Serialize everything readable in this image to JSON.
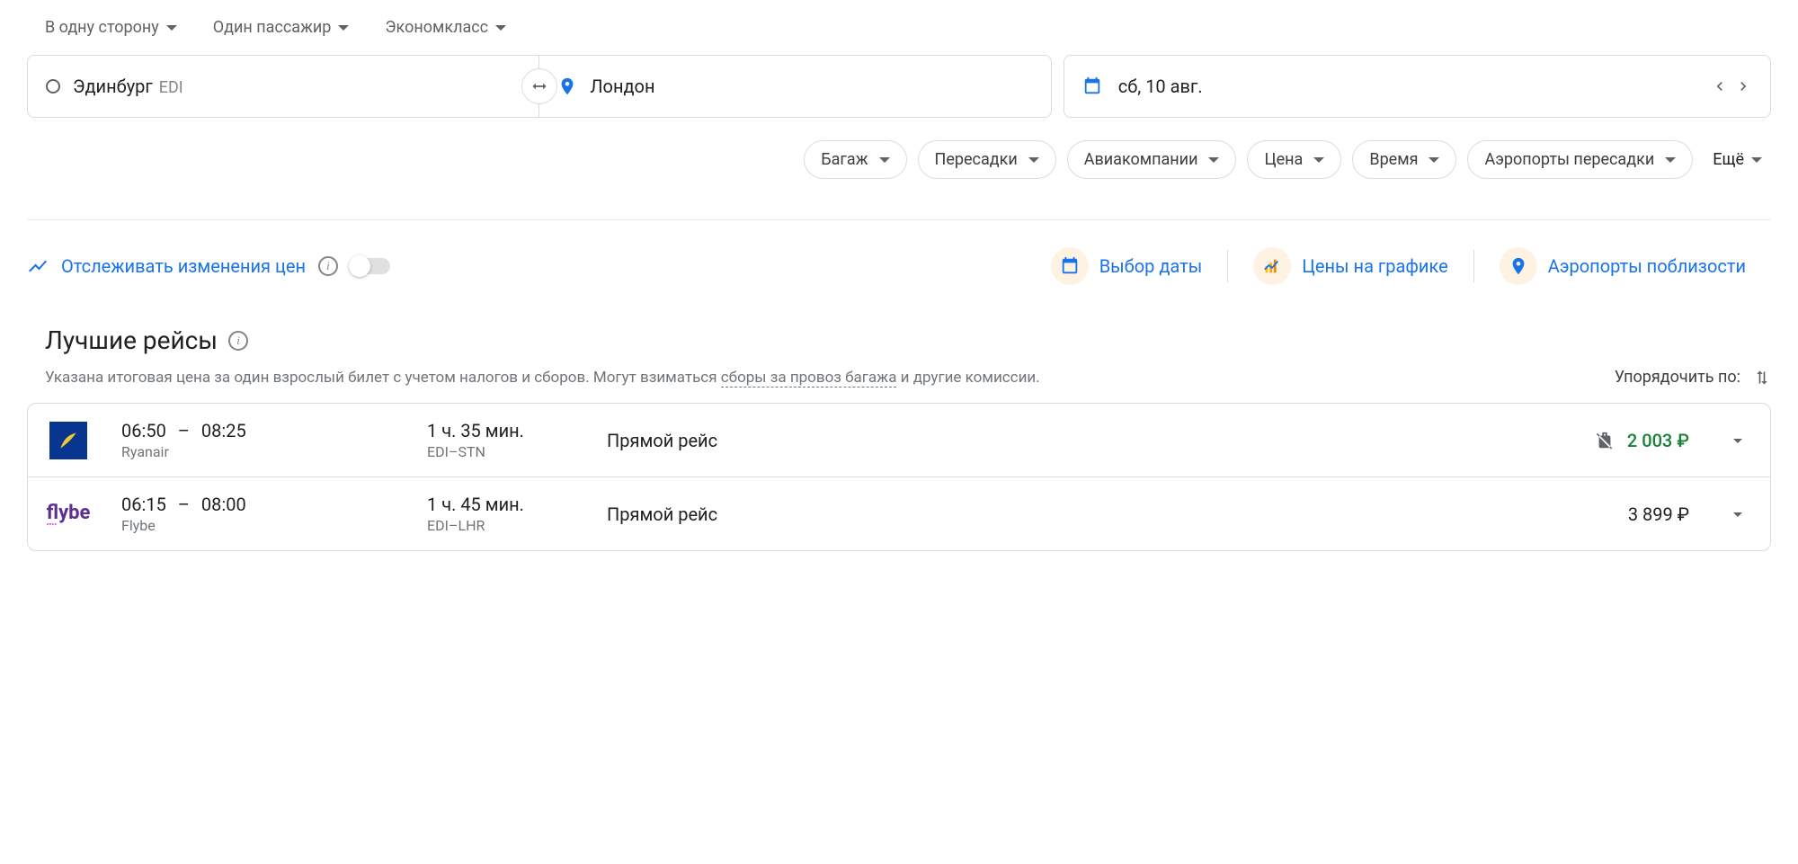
{
  "topFilters": {
    "tripType": "В одну сторону",
    "passengers": "Один пассажир",
    "cabin": "Экономкласс"
  },
  "search": {
    "origin": "Эдинбург",
    "originCode": "EDI",
    "destination": "Лондон",
    "date": "сб, 10 авг."
  },
  "chips": {
    "bags": "Багаж",
    "stops": "Пересадки",
    "airlines": "Авиакомпании",
    "price": "Цена",
    "time": "Время",
    "connectingAirports": "Аэропорты пересадки",
    "more": "Ещё"
  },
  "actions": {
    "trackPrices": "Отслеживать изменения цен",
    "dateSelect": "Выбор даты",
    "priceGraph": "Цены на графике",
    "nearbyAirports": "Аэропорты поблизости"
  },
  "section": {
    "title": "Лучшие рейсы",
    "subtitle1": "Указана итоговая цена за один взрослый билет с учетом налогов и сборов. Могут взиматься ",
    "subtitleLink": "сборы за провоз багажа",
    "subtitle2": " и другие комиссии.",
    "sortLabel": "Упорядочить по:"
  },
  "flights": [
    {
      "departTime": "06:50",
      "arriveTime": "08:25",
      "airline": "Ryanair",
      "duration": "1 ч. 35 мин.",
      "route": "EDI–STN",
      "stops": "Прямой рейс",
      "price": "2 003 ₽",
      "priceClass": "green",
      "noBag": true,
      "logoType": "ryanair"
    },
    {
      "departTime": "06:15",
      "arriveTime": "08:00",
      "airline": "Flybe",
      "duration": "1 ч. 45 мин.",
      "route": "EDI–LHR",
      "stops": "Прямой рейс",
      "price": "3 899 ₽",
      "priceClass": "normal",
      "noBag": false,
      "logoType": "flybe"
    }
  ]
}
